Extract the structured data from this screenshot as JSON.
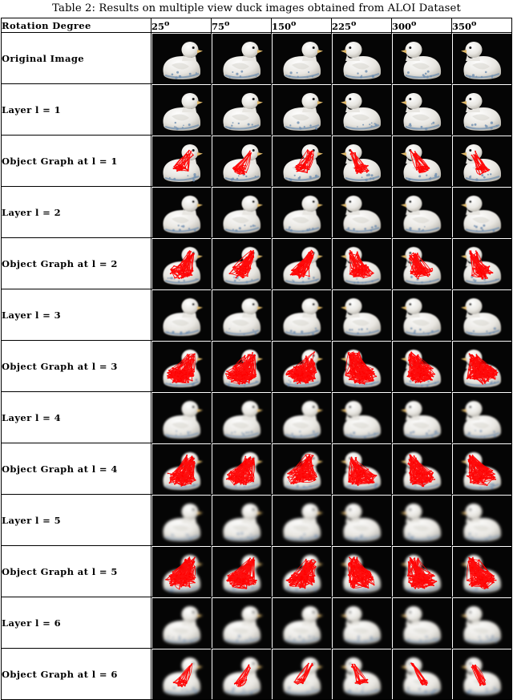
{
  "caption": "Table 2: Results on multiple view duck images obtained from ALOI Dataset",
  "table": {
    "corner_header": "Rotation Degree",
    "columns": [
      {
        "label": "25",
        "unit": "o"
      },
      {
        "label": "75",
        "unit": "o"
      },
      {
        "label": "150",
        "unit": "o"
      },
      {
        "label": "225",
        "unit": "o"
      },
      {
        "label": "300",
        "unit": "o"
      },
      {
        "label": "350",
        "unit": "o"
      }
    ],
    "rows": [
      {
        "label": "Original Image",
        "type": "plain",
        "graph": false,
        "level": 0
      },
      {
        "label": "Layer l = 1",
        "type": "layer",
        "graph": false,
        "level": 1
      },
      {
        "label": "Object Graph at l = 1",
        "type": "graph",
        "graph": true,
        "level": 1
      },
      {
        "label": "Layer l = 2",
        "type": "layer",
        "graph": false,
        "level": 2
      },
      {
        "label": "Object Graph at l = 2",
        "type": "graph",
        "graph": true,
        "level": 2
      },
      {
        "label": "Layer l = 3",
        "type": "layer",
        "graph": false,
        "level": 3
      },
      {
        "label": "Object Graph at l = 3",
        "type": "graph",
        "graph": true,
        "level": 3
      },
      {
        "label": "Layer l = 4",
        "type": "layer",
        "graph": false,
        "level": 4
      },
      {
        "label": "Object Graph at l = 4",
        "type": "graph",
        "graph": true,
        "level": 4
      },
      {
        "label": "Layer l = 5",
        "type": "layer",
        "graph": false,
        "level": 5
      },
      {
        "label": "Object Graph at l = 5",
        "type": "graph",
        "graph": true,
        "level": 5
      },
      {
        "label": "Layer l = 6",
        "type": "layer",
        "graph": false,
        "level": 6
      },
      {
        "label": "Object Graph at l = 6",
        "type": "graph",
        "graph": true,
        "level": 6
      }
    ],
    "colors": {
      "background": "#050505",
      "duck_body": "#e8e6e1",
      "duck_shadow": "#b9b6ae",
      "graph_overlay": "#ff0000",
      "accent_blue": "#6f8fb0",
      "border": "#000000"
    },
    "cell_image": "duck-photo"
  }
}
